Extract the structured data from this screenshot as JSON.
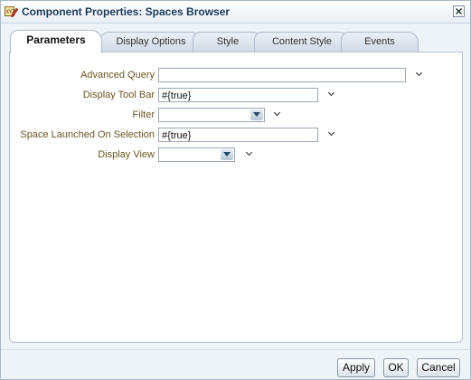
{
  "window": {
    "title": "Component Properties: Spaces Browser",
    "icon": "edit-properties-icon",
    "close_icon": "close-icon"
  },
  "tabs": [
    {
      "label": "Parameters",
      "active": true
    },
    {
      "label": "Display Options",
      "active": false
    },
    {
      "label": "Style",
      "active": false
    },
    {
      "label": "Content Style",
      "active": false
    },
    {
      "label": "Events",
      "active": false
    }
  ],
  "fields": {
    "advanced_query": {
      "label": "Advanced Query",
      "value": ""
    },
    "display_tool_bar": {
      "label": "Display Tool Bar",
      "value": "#{true}"
    },
    "filter": {
      "label": "Filter",
      "value": ""
    },
    "space_launched": {
      "label": "Space Launched On Selection",
      "value": "#{true}"
    },
    "display_view": {
      "label": "Display View",
      "value": ""
    }
  },
  "buttons": {
    "apply": "Apply",
    "ok": "OK",
    "cancel": "Cancel"
  },
  "colors": {
    "label_text": "#6b5520",
    "title_text": "#1b3a5c",
    "dialog_background": "#eef3f8"
  }
}
